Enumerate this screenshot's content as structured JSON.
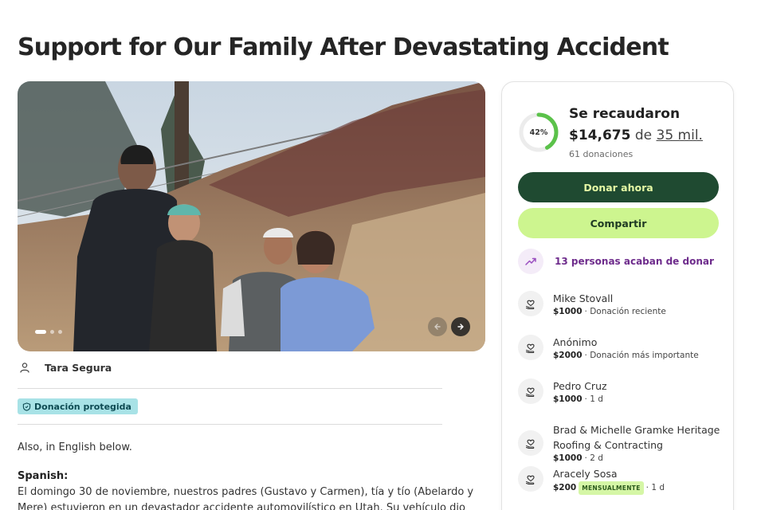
{
  "campaign": {
    "title": "Support for Our Family After Devastating Accident"
  },
  "organizer": {
    "name": "Tara Segura",
    "icon": "person-icon"
  },
  "badge": {
    "label": "Donación protegida",
    "icon": "shield-icon"
  },
  "story": {
    "intro": "Also, in English below.",
    "heading": "Spanish:",
    "line1": "El domingo 30 de noviembre, nuestros padres (Gustavo y Carmen), tía y tío (Abelardo y",
    "line2": "Mere) estuvieron en un devastador accidente automovilístico en Utah. Su vehículo dio"
  },
  "carousel": {
    "slide_count": 3,
    "active_slide": 1,
    "prev_icon": "arrow-left-icon",
    "next_icon": "arrow-right-icon"
  },
  "fundraising": {
    "percent_label": "42%",
    "percent_value": 0.42,
    "raised_label": "Se recaudaron",
    "amount": "$14,675",
    "connector": "de",
    "goal": "35 mil.",
    "donations_count": "61 donaciones"
  },
  "actions": {
    "donate_label": "Donar ahora",
    "share_label": "Compartir"
  },
  "recent": {
    "text": "13 personas acaban de donar",
    "icon": "trending-up-icon"
  },
  "donors": [
    {
      "name": "Mike Stovall",
      "amount": "$1000",
      "detail": "· Donación reciente",
      "badge": "",
      "icon": "heart-hand-icon"
    },
    {
      "name": "Anónimo",
      "amount": "$2000",
      "detail": "· Donación más importante",
      "badge": "",
      "icon": "heart-hand-icon"
    },
    {
      "name": "Pedro Cruz",
      "amount": "$1000",
      "detail": "· 1 d",
      "badge": "",
      "icon": "heart-hand-icon"
    },
    {
      "name": "Brad & Michelle Gramke Heritage Roofing & Contracting",
      "amount": "$1000",
      "detail": "· 2 d",
      "badge": "",
      "icon": "heart-hand-icon"
    },
    {
      "name": "Aracely Sosa",
      "amount": "$200",
      "detail": "· 1 d",
      "badge": "MENSUALMENTE",
      "icon": "heart-hand-icon"
    }
  ],
  "colors": {
    "accent_green": "#1f4a31",
    "share_green": "#cdf58f",
    "progress_green": "#5bc24a",
    "recent_purple": "#6e2c8c",
    "badge_teal": "#a8e2e6"
  }
}
